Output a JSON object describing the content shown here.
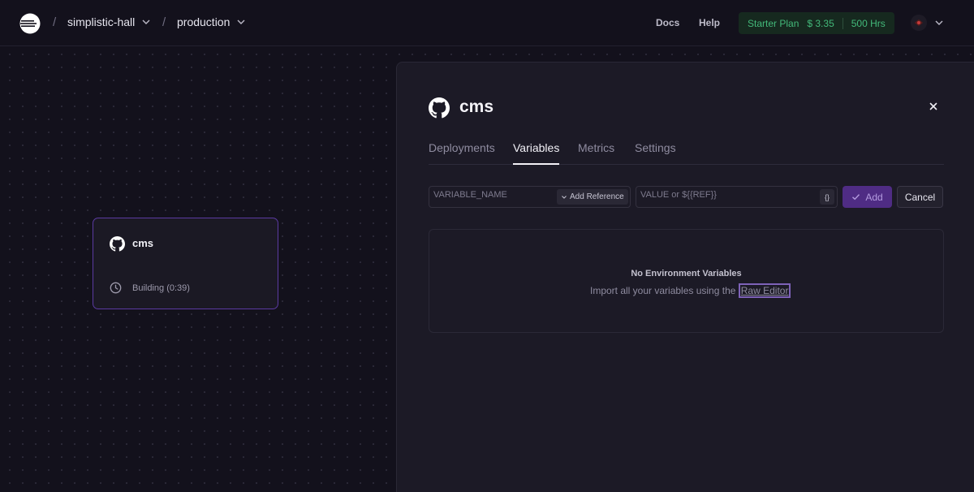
{
  "header": {
    "project": "simplistic-hall",
    "environment": "production",
    "separator": "/",
    "docs": "Docs",
    "help": "Help",
    "plan": {
      "name": "Starter Plan",
      "cost": "$ 3.35",
      "hours": "500 Hrs"
    }
  },
  "canvas": {
    "service_card": {
      "name": "cms",
      "status": "Building (0:39)"
    }
  },
  "panel": {
    "title": "cms",
    "tabs": [
      {
        "label": "Deployments"
      },
      {
        "label": "Variables",
        "active": true
      },
      {
        "label": "Metrics"
      },
      {
        "label": "Settings"
      }
    ],
    "variable_form": {
      "name_placeholder": "VARIABLE_NAME",
      "add_reference": "Add Reference",
      "value_placeholder": "VALUE or ${{REF}}",
      "brace_label": "{}",
      "add": "Add",
      "cancel": "Cancel"
    },
    "empty": {
      "title": "No Environment Variables",
      "desc": "Import all your variables using the ",
      "link": "Raw Editor"
    }
  },
  "colors": {
    "accent": "#5b3aa1",
    "plan_green": "#43b97a",
    "background": "#13111c"
  }
}
